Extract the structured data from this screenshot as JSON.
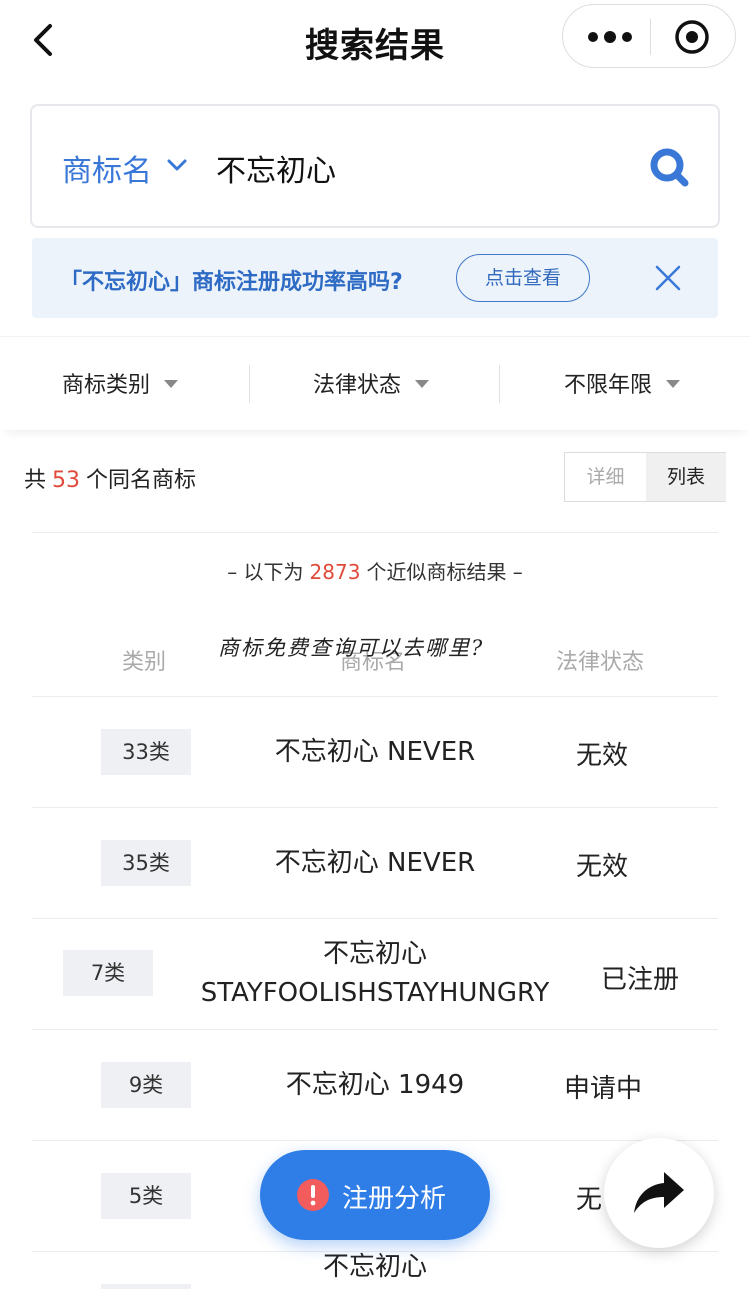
{
  "header": {
    "title": "搜索结果"
  },
  "search": {
    "type_label": "商标名",
    "query": "不忘初心"
  },
  "banner": {
    "text": "「不忘初心」商标注册成功率高吗?",
    "button_label": "点击查看"
  },
  "filters": [
    {
      "label": "商标类别"
    },
    {
      "label": "法律状态"
    },
    {
      "label": "不限年限"
    }
  ],
  "summary": {
    "prefix": "共",
    "count": "53",
    "suffix": "个同名商标"
  },
  "view_toggle": {
    "detail_label": "详细",
    "list_label": "列表",
    "active": "列表"
  },
  "similar": {
    "prefix": "– 以下为",
    "count": "2873",
    "suffix": "个近似商标结果 –"
  },
  "table_headers": {
    "class": "类别",
    "name": "商标名",
    "status": "法律状态"
  },
  "handwritten_note": "商标免费查询可以去哪里?",
  "rows": [
    {
      "class": "33类",
      "name": "不忘初心 NEVER",
      "status": "无效"
    },
    {
      "class": "35类",
      "name": "不忘初心 NEVER",
      "status": "无效"
    },
    {
      "class": "7类",
      "name": "不忘初心\nSTAYFOOLISHSTAYHUNGRY",
      "status": "已注册"
    },
    {
      "class": "9类",
      "name": "不忘初心 1949",
      "status": "申请中"
    },
    {
      "class": "5类",
      "name": "",
      "status": "无"
    },
    {
      "class": "",
      "name": "不忘初心",
      "status": ""
    }
  ],
  "fab": {
    "register_label": "注册分析"
  },
  "colors": {
    "accent": "#3a78d8",
    "highlight": "#e04a3a",
    "fab": "#2f7ee8"
  }
}
